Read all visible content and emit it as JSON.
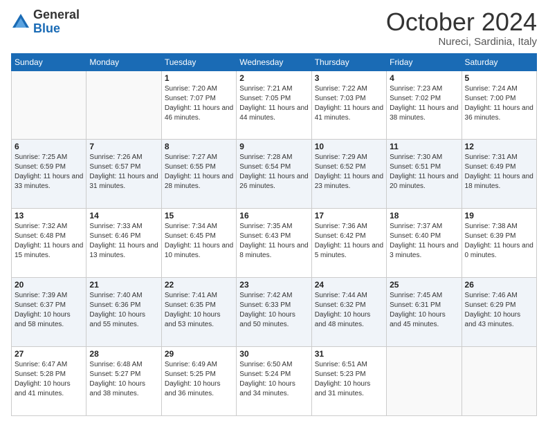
{
  "logo": {
    "general": "General",
    "blue": "Blue"
  },
  "title": {
    "month": "October 2024",
    "location": "Nureci, Sardinia, Italy"
  },
  "weekdays": [
    "Sunday",
    "Monday",
    "Tuesday",
    "Wednesday",
    "Thursday",
    "Friday",
    "Saturday"
  ],
  "weeks": [
    [
      {
        "day": "",
        "sunrise": "",
        "sunset": "",
        "daylight": ""
      },
      {
        "day": "",
        "sunrise": "",
        "sunset": "",
        "daylight": ""
      },
      {
        "day": "1",
        "sunrise": "Sunrise: 7:20 AM",
        "sunset": "Sunset: 7:07 PM",
        "daylight": "Daylight: 11 hours and 46 minutes."
      },
      {
        "day": "2",
        "sunrise": "Sunrise: 7:21 AM",
        "sunset": "Sunset: 7:05 PM",
        "daylight": "Daylight: 11 hours and 44 minutes."
      },
      {
        "day": "3",
        "sunrise": "Sunrise: 7:22 AM",
        "sunset": "Sunset: 7:03 PM",
        "daylight": "Daylight: 11 hours and 41 minutes."
      },
      {
        "day": "4",
        "sunrise": "Sunrise: 7:23 AM",
        "sunset": "Sunset: 7:02 PM",
        "daylight": "Daylight: 11 hours and 38 minutes."
      },
      {
        "day": "5",
        "sunrise": "Sunrise: 7:24 AM",
        "sunset": "Sunset: 7:00 PM",
        "daylight": "Daylight: 11 hours and 36 minutes."
      }
    ],
    [
      {
        "day": "6",
        "sunrise": "Sunrise: 7:25 AM",
        "sunset": "Sunset: 6:59 PM",
        "daylight": "Daylight: 11 hours and 33 minutes."
      },
      {
        "day": "7",
        "sunrise": "Sunrise: 7:26 AM",
        "sunset": "Sunset: 6:57 PM",
        "daylight": "Daylight: 11 hours and 31 minutes."
      },
      {
        "day": "8",
        "sunrise": "Sunrise: 7:27 AM",
        "sunset": "Sunset: 6:55 PM",
        "daylight": "Daylight: 11 hours and 28 minutes."
      },
      {
        "day": "9",
        "sunrise": "Sunrise: 7:28 AM",
        "sunset": "Sunset: 6:54 PM",
        "daylight": "Daylight: 11 hours and 26 minutes."
      },
      {
        "day": "10",
        "sunrise": "Sunrise: 7:29 AM",
        "sunset": "Sunset: 6:52 PM",
        "daylight": "Daylight: 11 hours and 23 minutes."
      },
      {
        "day": "11",
        "sunrise": "Sunrise: 7:30 AM",
        "sunset": "Sunset: 6:51 PM",
        "daylight": "Daylight: 11 hours and 20 minutes."
      },
      {
        "day": "12",
        "sunrise": "Sunrise: 7:31 AM",
        "sunset": "Sunset: 6:49 PM",
        "daylight": "Daylight: 11 hours and 18 minutes."
      }
    ],
    [
      {
        "day": "13",
        "sunrise": "Sunrise: 7:32 AM",
        "sunset": "Sunset: 6:48 PM",
        "daylight": "Daylight: 11 hours and 15 minutes."
      },
      {
        "day": "14",
        "sunrise": "Sunrise: 7:33 AM",
        "sunset": "Sunset: 6:46 PM",
        "daylight": "Daylight: 11 hours and 13 minutes."
      },
      {
        "day": "15",
        "sunrise": "Sunrise: 7:34 AM",
        "sunset": "Sunset: 6:45 PM",
        "daylight": "Daylight: 11 hours and 10 minutes."
      },
      {
        "day": "16",
        "sunrise": "Sunrise: 7:35 AM",
        "sunset": "Sunset: 6:43 PM",
        "daylight": "Daylight: 11 hours and 8 minutes."
      },
      {
        "day": "17",
        "sunrise": "Sunrise: 7:36 AM",
        "sunset": "Sunset: 6:42 PM",
        "daylight": "Daylight: 11 hours and 5 minutes."
      },
      {
        "day": "18",
        "sunrise": "Sunrise: 7:37 AM",
        "sunset": "Sunset: 6:40 PM",
        "daylight": "Daylight: 11 hours and 3 minutes."
      },
      {
        "day": "19",
        "sunrise": "Sunrise: 7:38 AM",
        "sunset": "Sunset: 6:39 PM",
        "daylight": "Daylight: 11 hours and 0 minutes."
      }
    ],
    [
      {
        "day": "20",
        "sunrise": "Sunrise: 7:39 AM",
        "sunset": "Sunset: 6:37 PM",
        "daylight": "Daylight: 10 hours and 58 minutes."
      },
      {
        "day": "21",
        "sunrise": "Sunrise: 7:40 AM",
        "sunset": "Sunset: 6:36 PM",
        "daylight": "Daylight: 10 hours and 55 minutes."
      },
      {
        "day": "22",
        "sunrise": "Sunrise: 7:41 AM",
        "sunset": "Sunset: 6:35 PM",
        "daylight": "Daylight: 10 hours and 53 minutes."
      },
      {
        "day": "23",
        "sunrise": "Sunrise: 7:42 AM",
        "sunset": "Sunset: 6:33 PM",
        "daylight": "Daylight: 10 hours and 50 minutes."
      },
      {
        "day": "24",
        "sunrise": "Sunrise: 7:44 AM",
        "sunset": "Sunset: 6:32 PM",
        "daylight": "Daylight: 10 hours and 48 minutes."
      },
      {
        "day": "25",
        "sunrise": "Sunrise: 7:45 AM",
        "sunset": "Sunset: 6:31 PM",
        "daylight": "Daylight: 10 hours and 45 minutes."
      },
      {
        "day": "26",
        "sunrise": "Sunrise: 7:46 AM",
        "sunset": "Sunset: 6:29 PM",
        "daylight": "Daylight: 10 hours and 43 minutes."
      }
    ],
    [
      {
        "day": "27",
        "sunrise": "Sunrise: 6:47 AM",
        "sunset": "Sunset: 5:28 PM",
        "daylight": "Daylight: 10 hours and 41 minutes."
      },
      {
        "day": "28",
        "sunrise": "Sunrise: 6:48 AM",
        "sunset": "Sunset: 5:27 PM",
        "daylight": "Daylight: 10 hours and 38 minutes."
      },
      {
        "day": "29",
        "sunrise": "Sunrise: 6:49 AM",
        "sunset": "Sunset: 5:25 PM",
        "daylight": "Daylight: 10 hours and 36 minutes."
      },
      {
        "day": "30",
        "sunrise": "Sunrise: 6:50 AM",
        "sunset": "Sunset: 5:24 PM",
        "daylight": "Daylight: 10 hours and 34 minutes."
      },
      {
        "day": "31",
        "sunrise": "Sunrise: 6:51 AM",
        "sunset": "Sunset: 5:23 PM",
        "daylight": "Daylight: 10 hours and 31 minutes."
      },
      {
        "day": "",
        "sunrise": "",
        "sunset": "",
        "daylight": ""
      },
      {
        "day": "",
        "sunrise": "",
        "sunset": "",
        "daylight": ""
      }
    ]
  ]
}
